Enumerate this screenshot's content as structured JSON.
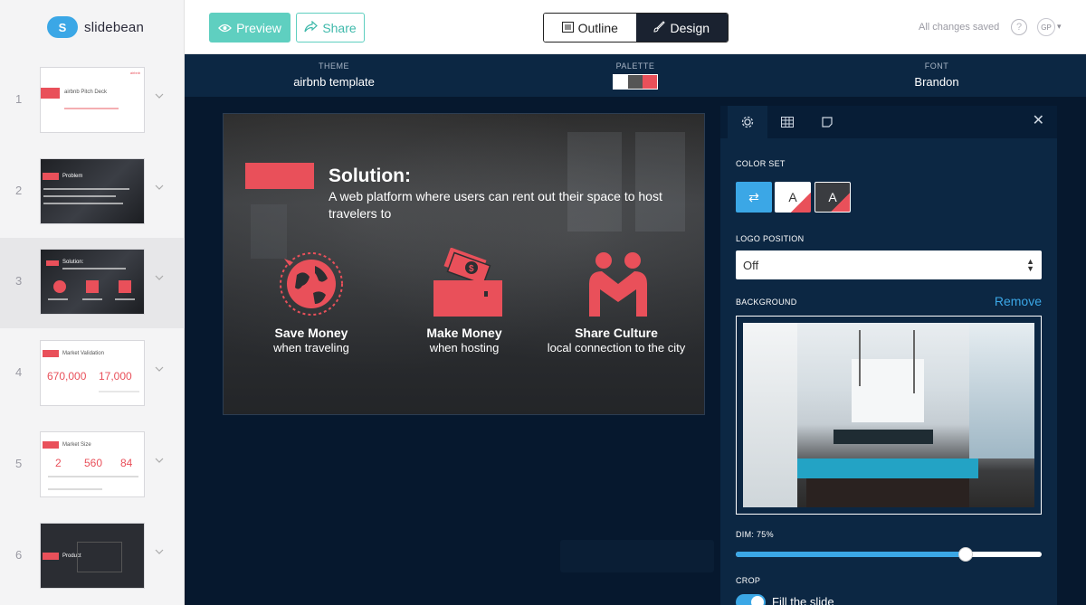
{
  "app": {
    "name": "slidebean",
    "logo_letter": "S"
  },
  "toolbar": {
    "preview_label": "Preview",
    "share_label": "Share",
    "outline_label": "Outline",
    "design_label": "Design",
    "saved_status": "All changes saved",
    "help_icon": "question-icon",
    "user_initials": "GP"
  },
  "design_bar": {
    "theme_label": "THEME",
    "theme_value": "airbnb template",
    "palette_label": "PALETTE",
    "palette_colors": [
      "#ffffff",
      "#555555",
      "#e9505a"
    ],
    "font_label": "FONT",
    "font_value": "Brandon"
  },
  "slides": [
    {
      "number": "1",
      "title": "airbnb Pitch Deck"
    },
    {
      "number": "2",
      "title": "Problem"
    },
    {
      "number": "3",
      "title": "Solution:",
      "active": true
    },
    {
      "number": "4",
      "title": "Market Validation",
      "stats": [
        "670,000",
        "17,000"
      ]
    },
    {
      "number": "5",
      "title": "Market Size",
      "stats": [
        "2",
        "560",
        "84"
      ]
    },
    {
      "number": "6",
      "title": "Product"
    }
  ],
  "slide": {
    "title": "Solution:",
    "subtitle": "A web platform where users can rent out their space to host travelers to",
    "features": [
      {
        "title": "Save Money",
        "subtitle": "when traveling",
        "icon": "globe-icon"
      },
      {
        "title": "Make Money",
        "subtitle": "when hosting",
        "icon": "wallet-money-icon"
      },
      {
        "title": "Share Culture",
        "subtitle": "local connection to the city",
        "icon": "handshake-icon"
      }
    ],
    "accent_color": "#e9505a"
  },
  "panel": {
    "tabs": [
      "settings-icon",
      "grid-icon",
      "note-icon"
    ],
    "color_set_label": "COLOR SET",
    "color_sets": [
      "⇄",
      "A",
      "A"
    ],
    "logo_position_label": "LOGO POSITION",
    "logo_position_value": "Off",
    "background_label": "BACKGROUND",
    "remove_label": "Remove",
    "dim_label": "DIM: 75%",
    "dim_value": 0.75,
    "crop_label": "CROP",
    "fill_label": "Fill the slide",
    "fill_on": true
  }
}
